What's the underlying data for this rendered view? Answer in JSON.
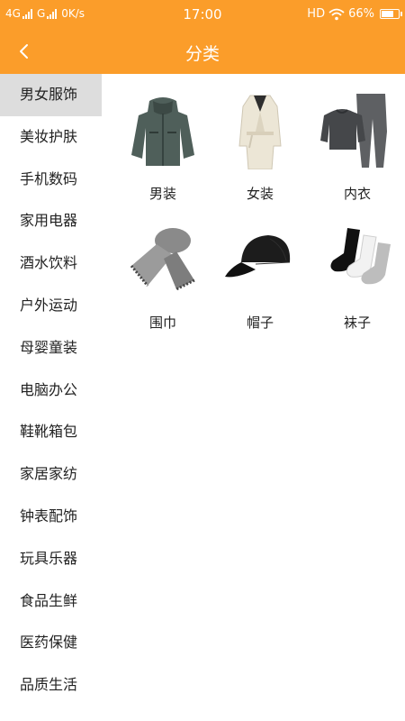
{
  "status_bar": {
    "network_left": "4G",
    "network_right": "G",
    "speed": "0K/s",
    "time": "17:00",
    "hd": "HD",
    "battery": "66%",
    "battery_level": 0.66
  },
  "header": {
    "title": "分类",
    "back_icon": "chevron-left-icon"
  },
  "colors": {
    "accent": "#fb9d2a",
    "sidebar_active_bg": "#dddddd"
  },
  "sidebar": {
    "items": [
      {
        "label": "男女服饰",
        "active": true
      },
      {
        "label": "美妆护肤"
      },
      {
        "label": "手机数码"
      },
      {
        "label": "家用电器"
      },
      {
        "label": "酒水饮料"
      },
      {
        "label": "户外运动"
      },
      {
        "label": "母婴童装"
      },
      {
        "label": "电脑办公"
      },
      {
        "label": "鞋靴箱包"
      },
      {
        "label": "家居家纺"
      },
      {
        "label": "钟表配饰"
      },
      {
        "label": "玩具乐器"
      },
      {
        "label": "食品生鲜"
      },
      {
        "label": "医药保健"
      },
      {
        "label": "品质生活"
      }
    ]
  },
  "categories": [
    {
      "label": "男装",
      "icon": "mens-jacket-image"
    },
    {
      "label": "女装",
      "icon": "womens-coat-image"
    },
    {
      "label": "内衣",
      "icon": "underwear-set-image"
    },
    {
      "label": "围巾",
      "icon": "scarf-image"
    },
    {
      "label": "帽子",
      "icon": "cap-image"
    },
    {
      "label": "袜子",
      "icon": "socks-image"
    }
  ]
}
